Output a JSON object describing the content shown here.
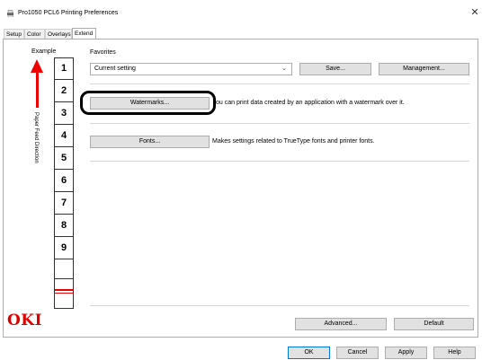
{
  "window": {
    "title": "Pro1050 PCL6 Printing Preferences",
    "close_glyph": "✕"
  },
  "tabs": [
    {
      "label": "Setup"
    },
    {
      "label": "Color"
    },
    {
      "label": "Overlays"
    },
    {
      "label": "Extend"
    }
  ],
  "example": {
    "label": "Example",
    "feed_label": "Paper Feed Direction",
    "pages": [
      "1",
      "2",
      "3",
      "4",
      "5",
      "6",
      "7",
      "8",
      "9"
    ]
  },
  "favorites": {
    "label": "Favorites",
    "selected": "Current setting",
    "save_label": "Save...",
    "management_label": "Management..."
  },
  "rows": {
    "watermarks_button": "Watermarks...",
    "watermarks_desc": "ou can print data created by an application with a watermark over it.",
    "fonts_button": "Fonts...",
    "fonts_desc": "Makes settings related to TrueType fonts and printer fonts."
  },
  "bottom": {
    "brand": "OKI",
    "advanced_label": "Advanced...",
    "default_label": "Default"
  },
  "dialog_buttons": {
    "ok": "OK",
    "cancel": "Cancel",
    "apply": "Apply",
    "help": "Help"
  },
  "colors": {
    "accent_red": "#e00000",
    "brand_red": "#d00000",
    "ok_border": "#0078d7"
  }
}
